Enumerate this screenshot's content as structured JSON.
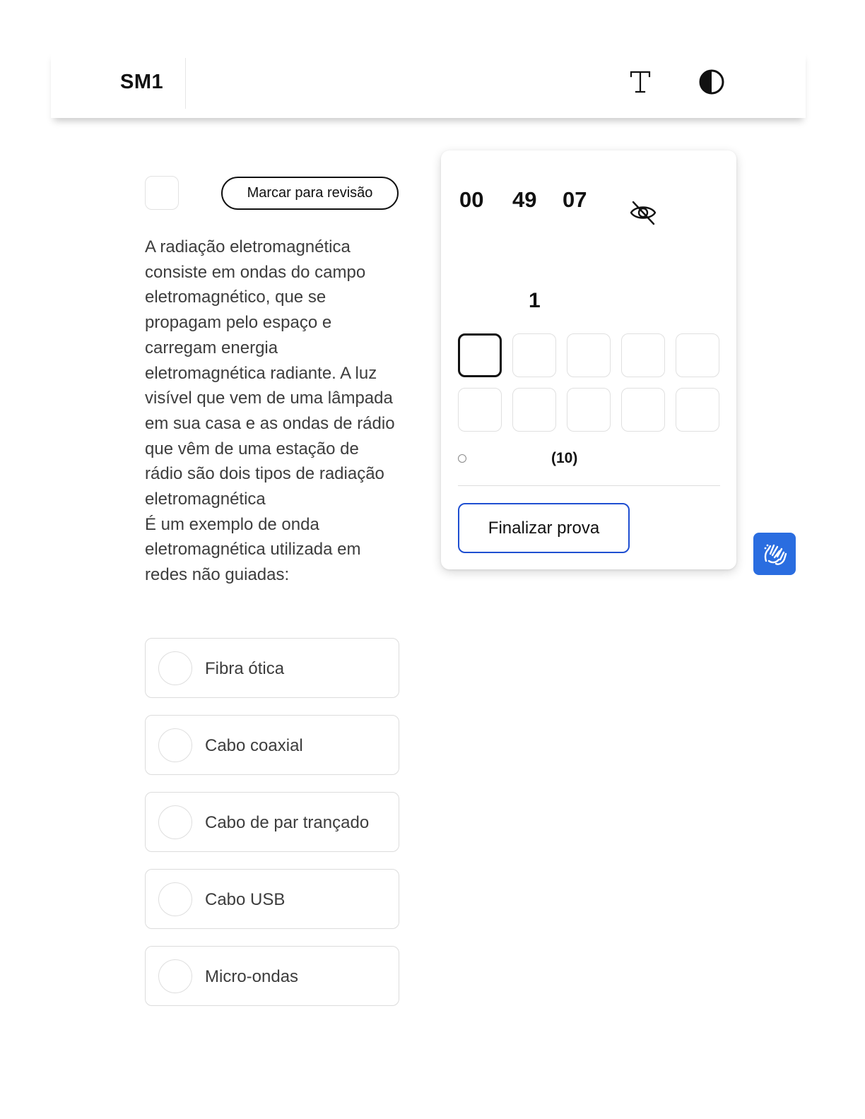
{
  "header": {
    "brand": "SM1",
    "font_size_icon": "font-size-icon",
    "contrast_icon": "contrast-icon"
  },
  "question": {
    "review_button_label": "Marcar para revisão",
    "text_lines": [
      "A radiação eletromagnética consiste em ondas do campo eletromagnético, que se propagam pelo espaço e carregam energia eletromagnética radiante. A luz visível que vem de uma lâmpada em sua casa e as ondas de rádio que vêm de uma estação de rádio são dois tipos de radiação eletromagnética",
      "É um exemplo de onda eletromagnética utilizada em redes não guiadas:"
    ],
    "options": [
      {
        "label": "Fibra ótica"
      },
      {
        "label": "Cabo coaxial"
      },
      {
        "label": "Cabo de par trançado"
      },
      {
        "label": "Cabo USB"
      },
      {
        "label": "Micro-ondas"
      }
    ]
  },
  "panel": {
    "timer": {
      "hours": "00",
      "minutes": "49",
      "seconds": "07"
    },
    "hide_timer_icon": "eye-off-icon",
    "current_question": "1",
    "question_count": 10,
    "active_question_index": 0,
    "legend_count": "(10)",
    "finish_label": "Finalizar prova"
  },
  "accessibility": {
    "icon": "sign-language-hands-icon",
    "color": "#2a6de0"
  },
  "colors": {
    "finish_border": "#1f4fd1",
    "text_muted": "#3d3d3d"
  }
}
